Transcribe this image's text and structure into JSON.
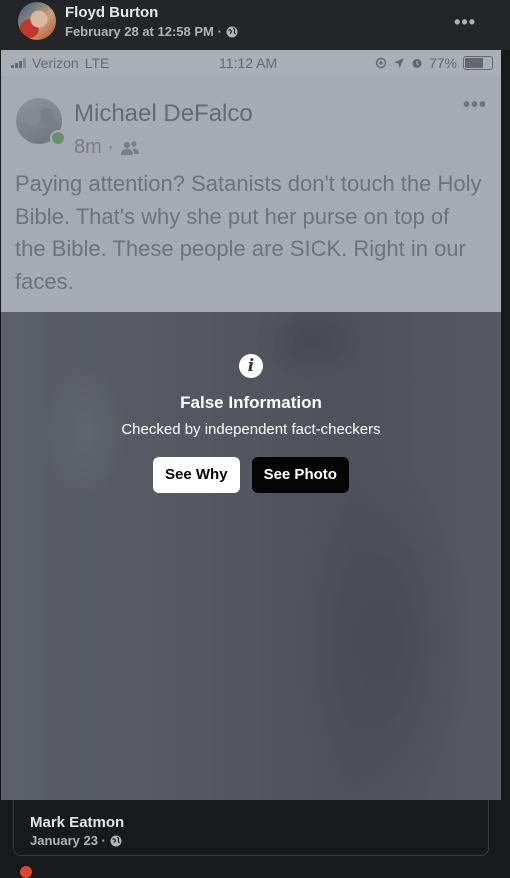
{
  "post": {
    "author": "Floyd Burton",
    "date": "February 28 at 12:58 PM · ",
    "privacy_icon": "globe-icon",
    "more_icon": "more-options-icon"
  },
  "screenshot": {
    "status_bar": {
      "carrier": "Verizon",
      "network": "LTE",
      "time": "11:12 AM",
      "battery": "77%",
      "battery_level": 0.77
    },
    "inner_post": {
      "author": "Michael DeFalco",
      "time": "8m ·",
      "audience_icon": "friends-icon",
      "text": "Paying attention? Satanists don't touch the Holy Bible. That's why she put her purse on top of the Bible. These people are SICK. Right in our faces."
    }
  },
  "warning": {
    "icon": "info-icon",
    "glyph": "i",
    "title": "False Information",
    "subtitle": "Checked by independent fact-checkers",
    "see_why": "See Why",
    "see_photo": "See Photo"
  },
  "shared": {
    "author": "Mark Eatmon",
    "date": "January 23 · ",
    "privacy_icon": "globe-icon"
  },
  "colors": {
    "background": "#18191a",
    "card": "#242526",
    "primary_text": "#e4e6eb",
    "secondary_text": "#b0b3b8"
  }
}
